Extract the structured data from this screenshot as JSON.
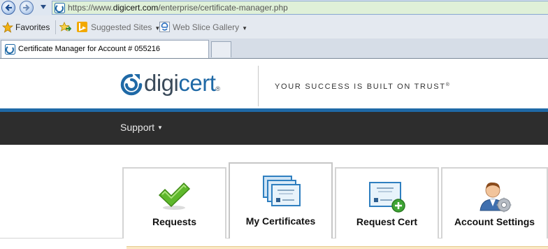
{
  "browser": {
    "url_scheme": "https://www.",
    "url_host": "digicert.com",
    "url_path": "/enterprise/certificate-manager.php",
    "favorites": {
      "favorites_label": "Favorites",
      "suggested_sites_label": "Suggested Sites",
      "web_slice_gallery_label": "Web Slice Gallery"
    },
    "tab_title": "Certificate Manager for Account # 055216"
  },
  "site": {
    "logo_digi": "digi",
    "logo_cert": "cert",
    "logo_reg": "®",
    "tagline": "YOUR SUCCESS IS BUILT ON TRUST",
    "tagline_reg": "®",
    "nav_support": "Support",
    "brand_color": "#1f69a6",
    "nav_color": "#2d2d2d"
  },
  "tabs": [
    {
      "label": "Requests",
      "icon": "checkmark-icon"
    },
    {
      "label": "My Certificates",
      "icon": "certificates-stack-icon",
      "active": true
    },
    {
      "label": "Request Cert",
      "icon": "certificate-add-icon"
    },
    {
      "label": "Account Settings",
      "icon": "user-gear-icon"
    }
  ]
}
